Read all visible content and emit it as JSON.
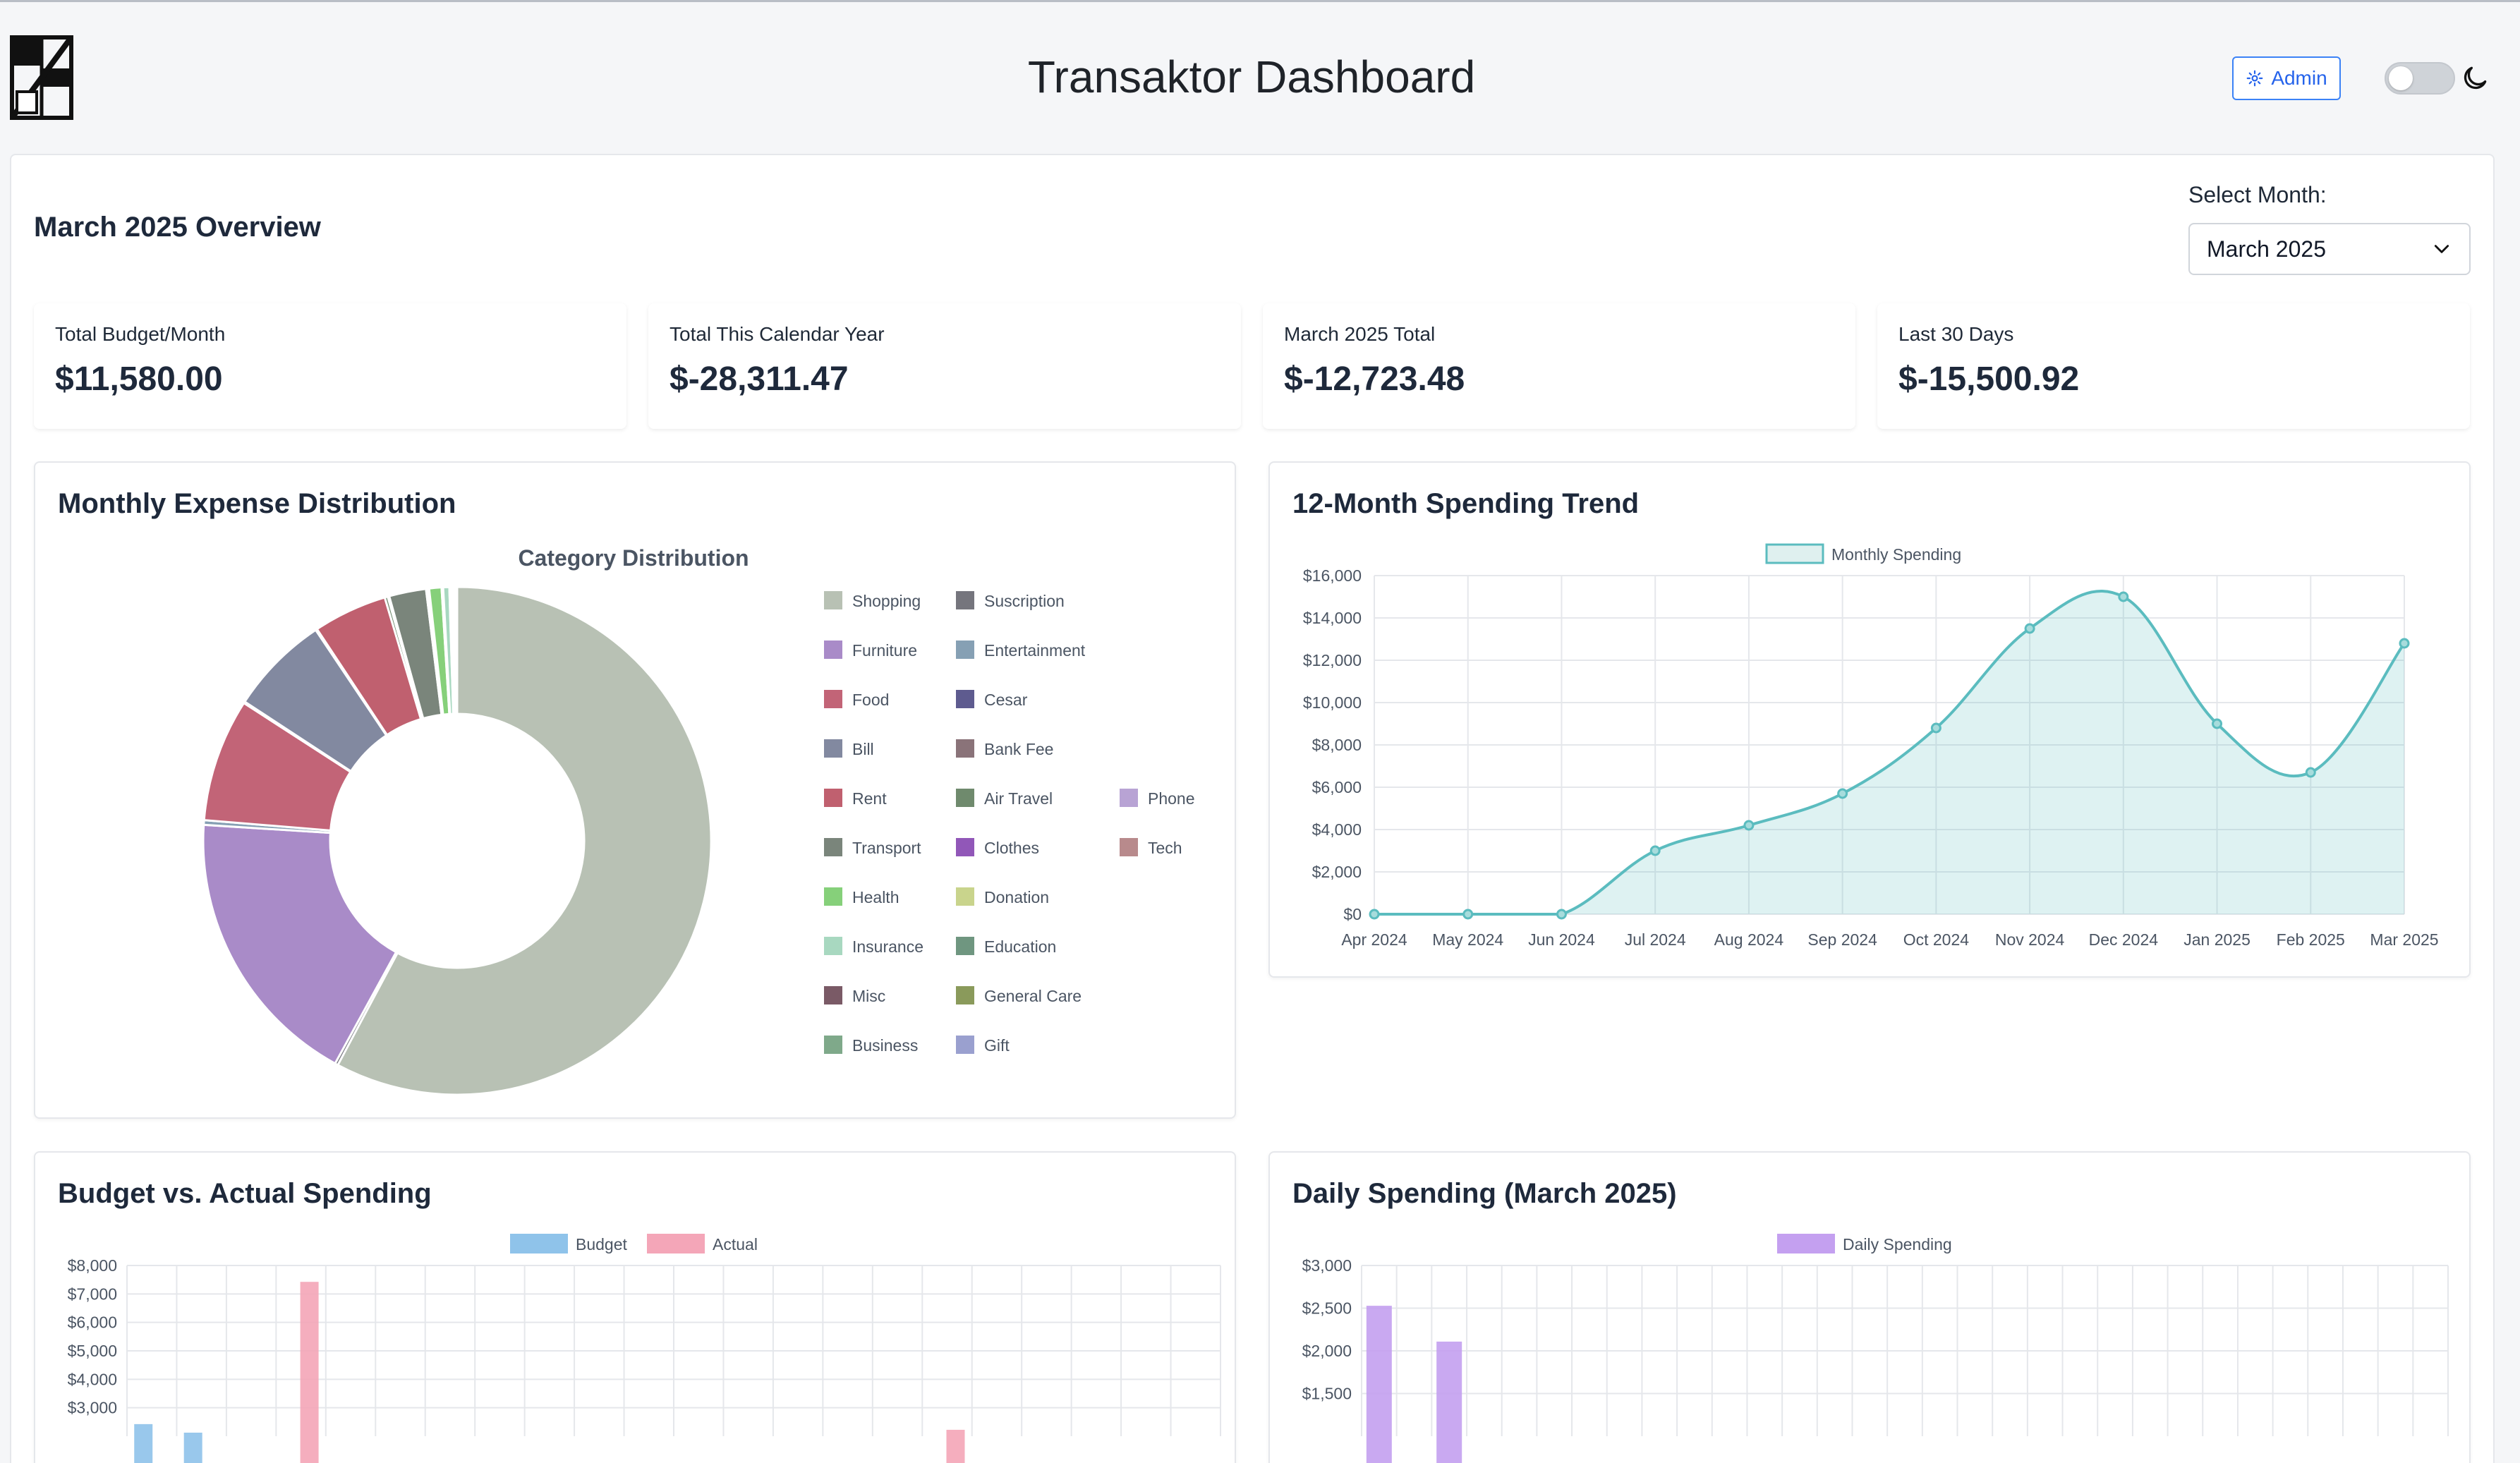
{
  "header": {
    "title": "Transaktor Dashboard",
    "admin_label": "Admin"
  },
  "overview": {
    "title": "March 2025 Overview",
    "select_label": "Select Month:",
    "selected_month": "March 2025"
  },
  "stats": [
    {
      "label": "Total Budget/Month",
      "value": "$11,580.00"
    },
    {
      "label": "Total This Calendar Year",
      "value": "$-28,311.47"
    },
    {
      "label": "March 2025 Total",
      "value": "$-12,723.48"
    },
    {
      "label": "Last 30 Days",
      "value": "$-15,500.92"
    }
  ],
  "cards": {
    "distribution_title": "Monthly Expense Distribution",
    "trend_title": "12-Month Spending Trend",
    "budget_title": "Budget vs. Actual Spending",
    "daily_title": "Daily Spending (March 2025)"
  },
  "chart_data": [
    {
      "type": "pie",
      "title": "Category Distribution",
      "categories": [
        "Shopping",
        "Suscription",
        "Furniture",
        "Entertainment",
        "Food",
        "Cesar",
        "Bill",
        "Bank Fee",
        "Rent",
        "Air Travel",
        "Phone",
        "Transport",
        "Clothes",
        "Tech",
        "Health",
        "Donation",
        "Insurance",
        "Education",
        "Misc",
        "General Care",
        "Business",
        "Gift"
      ],
      "colors": [
        "#b8c1b4",
        "#75757d",
        "#a98bc8",
        "#86a0b4",
        "#c26477",
        "#5e5b8f",
        "#8289a0",
        "#8a7379",
        "#c0606f",
        "#6f8a6d",
        "#b8a3d4",
        "#7a857b",
        "#9157b8",
        "#b88a8c",
        "#86d07a",
        "#c9d48c",
        "#a8d8c0",
        "#6f9680",
        "#7a5a66",
        "#8a9a5b",
        "#7fa98a",
        "#9aa0cf"
      ],
      "values": [
        59.0,
        0.2,
        18.4,
        0.3,
        8.0,
        0.1,
        6.5,
        0.1,
        4.8,
        0.2,
        0.1,
        2.4,
        0.1,
        0.1,
        0.8,
        0.1,
        0.4,
        0.1,
        0.1,
        0.1,
        0.1,
        0.1
      ],
      "legend_position": "right"
    },
    {
      "type": "area",
      "series": [
        {
          "name": "Monthly Spending",
          "values": [
            0,
            0,
            0,
            3000,
            4200,
            5700,
            8800,
            13500,
            15000,
            9000,
            6700,
            12800
          ]
        }
      ],
      "x": [
        "Apr 2024",
        "May 2024",
        "Jun 2024",
        "Jul 2024",
        "Aug 2024",
        "Sep 2024",
        "Oct 2024",
        "Nov 2024",
        "Dec 2024",
        "Jan 2025",
        "Feb 2025",
        "Mar 2025"
      ],
      "y_ticks": [
        "$0",
        "$2,000",
        "$4,000",
        "$6,000",
        "$8,000",
        "$10,000",
        "$12,000",
        "$14,000",
        "$16,000"
      ],
      "ylim": [
        0,
        16000
      ],
      "grid": true,
      "color": "#5bbcbf",
      "legend_position": "top"
    },
    {
      "type": "bar",
      "series": [
        {
          "name": "Budget",
          "color": "#8fc3ea",
          "values": [
            2400,
            2100,
            0,
            0,
            0,
            0,
            0,
            0,
            0,
            0,
            0,
            0,
            0,
            0,
            0,
            0,
            0,
            0,
            0,
            0,
            0,
            0
          ]
        },
        {
          "name": "Actual",
          "color": "#f4a6b8",
          "values": [
            0,
            0,
            0,
            7400,
            0,
            0,
            0,
            0,
            0,
            0,
            0,
            0,
            0,
            0,
            0,
            0,
            2200,
            0,
            0,
            0,
            0,
            0
          ]
        }
      ],
      "y_ticks": [
        "$3,000",
        "$4,000",
        "$5,000",
        "$6,000",
        "$7,000",
        "$8,000"
      ],
      "ylim": [
        2000,
        8000
      ],
      "grid": true,
      "legend_position": "top"
    },
    {
      "type": "bar",
      "series": [
        {
          "name": "Daily Spending",
          "color": "#c4a0f0",
          "values": [
            2520,
            0,
            2100,
            0,
            0,
            0,
            0,
            0,
            0,
            0,
            0,
            0,
            0,
            0,
            0,
            0,
            0,
            0,
            0,
            0,
            0,
            0,
            0,
            0,
            0,
            0,
            0,
            0,
            0,
            0,
            0
          ]
        }
      ],
      "y_ticks": [
        "$1,500",
        "$2,000",
        "$2,500",
        "$3,000"
      ],
      "ylim": [
        1000,
        3000
      ],
      "grid": true,
      "legend_position": "top"
    }
  ]
}
